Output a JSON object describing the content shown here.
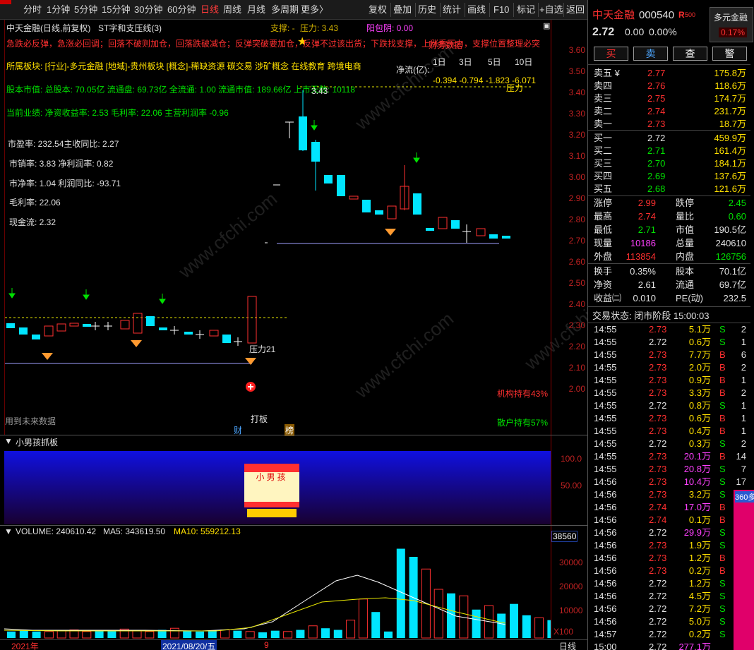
{
  "toolbar": {
    "periods": [
      "分时",
      "1分钟",
      "5分钟",
      "15分钟",
      "30分钟",
      "60分钟",
      "日线",
      "周线",
      "月线",
      "多周期",
      "更多〉"
    ],
    "active_period": "日线",
    "tools": [
      "复权",
      "叠加",
      "历史",
      "统计",
      "画线",
      "F10",
      "标记",
      "+自选",
      "返回"
    ]
  },
  "chart_header": {
    "title": "中天金融(日线,前复权)",
    "indicator": "ST字和支压线(3)",
    "support_label": "支撑: -",
    "pressure_label": "压力: 3.43",
    "yang_label": "阳包阴: 0.00"
  },
  "overlay_text": {
    "red_line": "急跌必反弹，急涨必回调；回落不破则加仓，回落跌破减仓；反弹突破要加仓，反弹不过该出货；下跌找支撑，上涨看压力，支撑位置整理必突",
    "right_red": "财务数据",
    "sector": "所属板块: [行业]-多元金融 [地域]-贵州板块 [概念]-稀缺资源 碳交易 涉矿概念 在线教育 跨境电商",
    "equity": "股本市值: 总股本: 70.05亿 流通盘: 69.73亿 全流通: 1.00 流通市值: 189.66亿 上市天数: 10118",
    "performance": "当前业绩:  净资收益率: 2.53 毛利率: 22.06 主营利润率 -0.96",
    "pe": "市盈率: 232.54主收同比: 2.27",
    "ps": "市销率: 3.83  净利润率: 0.82",
    "pb": "市净率: 1.04  利润同比: -93.71",
    "gross": "毛利率: 22.06",
    "cash": "现金流: 2.32",
    "flow_title": "净流(亿):",
    "flow_periods": [
      "1日",
      "3日",
      "5日",
      "10日"
    ],
    "flow_values": "-0.394 -0.794 -1.823 -6.071",
    "high_label": "3.43",
    "pressure_tag": "压力",
    "support_tag": "压力21",
    "inst": "机构持有43%",
    "retail": "散户持有57%",
    "future": "用到未来数据",
    "daban": "打板",
    "cai": "财",
    "bang": "榜"
  },
  "price_scale": [
    "3.60",
    "3.50",
    "3.40",
    "3.30",
    "3.20",
    "3.10",
    "3.00",
    "2.90",
    "2.80",
    "2.70",
    "2.60",
    "2.50",
    "2.40",
    "2.30",
    "2.20",
    "2.10",
    "2.00"
  ],
  "sub1": {
    "title": "小男孩抓板",
    "scale": [
      "100.0",
      "50.00"
    ],
    "glyph": "小男孩"
  },
  "sub2": {
    "label": "VOLUME: 240610.42",
    "ma5": "MA5: 343619.50",
    "ma10": "MA10: 559212.13",
    "scale_top": "38560",
    "scale": [
      "30000",
      "20000",
      "10000"
    ],
    "unit": "X100"
  },
  "bottom": {
    "year": "2021年",
    "date": "2021/08/20/五",
    "tick": "9",
    "period": "日线"
  },
  "quote": {
    "name": "中天金融",
    "code": "000540",
    "rtag": "R",
    "rnum": "500",
    "sector_badge": "多元金融",
    "sector_pct": "0.17%",
    "price": "2.72",
    "change": "0.00",
    "pct": "0.00%",
    "buttons": [
      "买",
      "卖",
      "查",
      "警"
    ],
    "asks": [
      {
        "label": "卖五 ¥",
        "price": "2.77",
        "vol": "175.8万"
      },
      {
        "label": "卖四",
        "price": "2.76",
        "vol": "118.6万"
      },
      {
        "label": "卖三",
        "price": "2.75",
        "vol": "174.7万"
      },
      {
        "label": "卖二",
        "price": "2.74",
        "vol": "231.7万"
      },
      {
        "label": "卖一",
        "price": "2.73",
        "vol": "18.7万"
      }
    ],
    "bids": [
      {
        "label": "买一",
        "price": "2.72",
        "vol": "459.9万"
      },
      {
        "label": "买二",
        "price": "2.71",
        "vol": "161.4万"
      },
      {
        "label": "买三",
        "price": "2.70",
        "vol": "184.1万"
      },
      {
        "label": "买四",
        "price": "2.69",
        "vol": "137.6万"
      },
      {
        "label": "买五",
        "price": "2.68",
        "vol": "121.6万"
      }
    ],
    "stats": [
      {
        "l1": "涨停",
        "v1": "2.99",
        "l2": "跌停",
        "v2": "2.45"
      },
      {
        "l1": "最高",
        "v1": "2.74",
        "l2": "量比",
        "v2": "0.60"
      },
      {
        "l1": "最低",
        "v1": "2.71",
        "l2": "市值",
        "v2": "190.5亿"
      },
      {
        "l1": "现量",
        "v1": "10186",
        "l2": "总量",
        "v2": "240610"
      },
      {
        "l1": "外盘",
        "v1": "113854",
        "l2": "内盘",
        "v2": "126756"
      }
    ],
    "stats2": [
      {
        "l1": "换手",
        "v1": "0.35%",
        "l2": "股本",
        "v2": "70.1亿"
      },
      {
        "l1": "净资",
        "v1": "2.61",
        "l2": "流通",
        "v2": "69.7亿"
      },
      {
        "l1": "收益㈡",
        "v1": "0.010",
        "l2": "PE(动)",
        "v2": "232.5"
      }
    ],
    "status": "交易状态: 闭市阶段 15:00:03",
    "ticks": [
      [
        "14:55",
        "2.73",
        "5.1万",
        "S",
        "2"
      ],
      [
        "14:55",
        "2.72",
        "0.6万",
        "S",
        "1"
      ],
      [
        "14:55",
        "2.73",
        "7.7万",
        "B",
        "6"
      ],
      [
        "14:55",
        "2.73",
        "2.0万",
        "B",
        "2"
      ],
      [
        "14:55",
        "2.73",
        "0.9万",
        "B",
        "1"
      ],
      [
        "14:55",
        "2.73",
        "3.3万",
        "B",
        "2"
      ],
      [
        "14:55",
        "2.72",
        "0.8万",
        "S",
        "1"
      ],
      [
        "14:55",
        "2.73",
        "0.6万",
        "B",
        "1"
      ],
      [
        "14:55",
        "2.73",
        "0.4万",
        "B",
        "1"
      ],
      [
        "14:55",
        "2.72",
        "0.3万",
        "S",
        "2"
      ],
      [
        "14:55",
        "2.73",
        "20.1万",
        "B",
        "14"
      ],
      [
        "14:55",
        "2.73",
        "20.8万",
        "S",
        "7"
      ],
      [
        "14:56",
        "2.73",
        "10.4万",
        "S",
        "17"
      ],
      [
        "14:56",
        "2.73",
        "3.2万",
        "S",
        ""
      ],
      [
        "14:56",
        "2.74",
        "17.0万",
        "B",
        ""
      ],
      [
        "14:56",
        "2.74",
        "0.1万",
        "B",
        ""
      ],
      [
        "14:56",
        "2.72",
        "29.9万",
        "S",
        ""
      ],
      [
        "14:56",
        "2.73",
        "1.9万",
        "S",
        ""
      ],
      [
        "14:56",
        "2.73",
        "1.2万",
        "B",
        ""
      ],
      [
        "14:56",
        "2.73",
        "0.2万",
        "B",
        ""
      ],
      [
        "14:56",
        "2.72",
        "1.2万",
        "S",
        ""
      ],
      [
        "14:56",
        "2.72",
        "4.5万",
        "S",
        ""
      ],
      [
        "14:56",
        "2.72",
        "7.2万",
        "S",
        ""
      ],
      [
        "14:56",
        "2.72",
        "5.0万",
        "S",
        ""
      ],
      [
        "14:57",
        "2.72",
        "0.2万",
        "S",
        ""
      ],
      [
        "15:00",
        "2.72",
        "277.1万",
        "",
        ""
      ]
    ],
    "side_badge": "360多"
  },
  "watermark": "www.cfchi.com",
  "colors": {
    "up": "#ff3030",
    "down": "#00e5ff",
    "bg": "#000000",
    "accent": "#ffe000"
  }
}
